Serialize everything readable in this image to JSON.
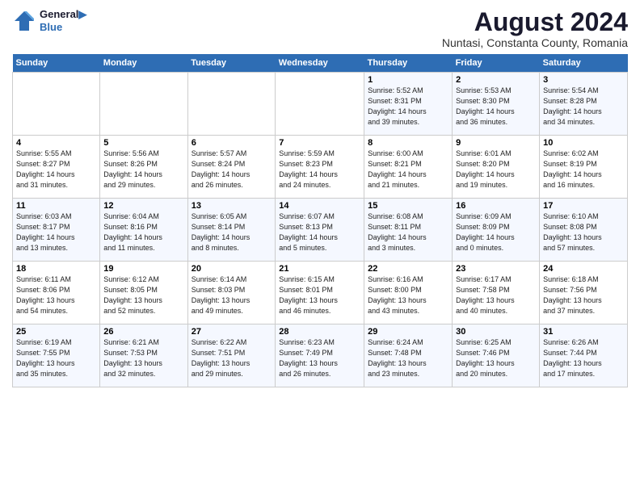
{
  "logo": {
    "line1": "General",
    "line2": "Blue"
  },
  "title": "August 2024",
  "subtitle": "Nuntasi, Constanta County, Romania",
  "days_of_week": [
    "Sunday",
    "Monday",
    "Tuesday",
    "Wednesday",
    "Thursday",
    "Friday",
    "Saturday"
  ],
  "weeks": [
    [
      {
        "day": "",
        "info": ""
      },
      {
        "day": "",
        "info": ""
      },
      {
        "day": "",
        "info": ""
      },
      {
        "day": "",
        "info": ""
      },
      {
        "day": "1",
        "info": "Sunrise: 5:52 AM\nSunset: 8:31 PM\nDaylight: 14 hours\nand 39 minutes."
      },
      {
        "day": "2",
        "info": "Sunrise: 5:53 AM\nSunset: 8:30 PM\nDaylight: 14 hours\nand 36 minutes."
      },
      {
        "day": "3",
        "info": "Sunrise: 5:54 AM\nSunset: 8:28 PM\nDaylight: 14 hours\nand 34 minutes."
      }
    ],
    [
      {
        "day": "4",
        "info": "Sunrise: 5:55 AM\nSunset: 8:27 PM\nDaylight: 14 hours\nand 31 minutes."
      },
      {
        "day": "5",
        "info": "Sunrise: 5:56 AM\nSunset: 8:26 PM\nDaylight: 14 hours\nand 29 minutes."
      },
      {
        "day": "6",
        "info": "Sunrise: 5:57 AM\nSunset: 8:24 PM\nDaylight: 14 hours\nand 26 minutes."
      },
      {
        "day": "7",
        "info": "Sunrise: 5:59 AM\nSunset: 8:23 PM\nDaylight: 14 hours\nand 24 minutes."
      },
      {
        "day": "8",
        "info": "Sunrise: 6:00 AM\nSunset: 8:21 PM\nDaylight: 14 hours\nand 21 minutes."
      },
      {
        "day": "9",
        "info": "Sunrise: 6:01 AM\nSunset: 8:20 PM\nDaylight: 14 hours\nand 19 minutes."
      },
      {
        "day": "10",
        "info": "Sunrise: 6:02 AM\nSunset: 8:19 PM\nDaylight: 14 hours\nand 16 minutes."
      }
    ],
    [
      {
        "day": "11",
        "info": "Sunrise: 6:03 AM\nSunset: 8:17 PM\nDaylight: 14 hours\nand 13 minutes."
      },
      {
        "day": "12",
        "info": "Sunrise: 6:04 AM\nSunset: 8:16 PM\nDaylight: 14 hours\nand 11 minutes."
      },
      {
        "day": "13",
        "info": "Sunrise: 6:05 AM\nSunset: 8:14 PM\nDaylight: 14 hours\nand 8 minutes."
      },
      {
        "day": "14",
        "info": "Sunrise: 6:07 AM\nSunset: 8:13 PM\nDaylight: 14 hours\nand 5 minutes."
      },
      {
        "day": "15",
        "info": "Sunrise: 6:08 AM\nSunset: 8:11 PM\nDaylight: 14 hours\nand 3 minutes."
      },
      {
        "day": "16",
        "info": "Sunrise: 6:09 AM\nSunset: 8:09 PM\nDaylight: 14 hours\nand 0 minutes."
      },
      {
        "day": "17",
        "info": "Sunrise: 6:10 AM\nSunset: 8:08 PM\nDaylight: 13 hours\nand 57 minutes."
      }
    ],
    [
      {
        "day": "18",
        "info": "Sunrise: 6:11 AM\nSunset: 8:06 PM\nDaylight: 13 hours\nand 54 minutes."
      },
      {
        "day": "19",
        "info": "Sunrise: 6:12 AM\nSunset: 8:05 PM\nDaylight: 13 hours\nand 52 minutes."
      },
      {
        "day": "20",
        "info": "Sunrise: 6:14 AM\nSunset: 8:03 PM\nDaylight: 13 hours\nand 49 minutes."
      },
      {
        "day": "21",
        "info": "Sunrise: 6:15 AM\nSunset: 8:01 PM\nDaylight: 13 hours\nand 46 minutes."
      },
      {
        "day": "22",
        "info": "Sunrise: 6:16 AM\nSunset: 8:00 PM\nDaylight: 13 hours\nand 43 minutes."
      },
      {
        "day": "23",
        "info": "Sunrise: 6:17 AM\nSunset: 7:58 PM\nDaylight: 13 hours\nand 40 minutes."
      },
      {
        "day": "24",
        "info": "Sunrise: 6:18 AM\nSunset: 7:56 PM\nDaylight: 13 hours\nand 37 minutes."
      }
    ],
    [
      {
        "day": "25",
        "info": "Sunrise: 6:19 AM\nSunset: 7:55 PM\nDaylight: 13 hours\nand 35 minutes."
      },
      {
        "day": "26",
        "info": "Sunrise: 6:21 AM\nSunset: 7:53 PM\nDaylight: 13 hours\nand 32 minutes."
      },
      {
        "day": "27",
        "info": "Sunrise: 6:22 AM\nSunset: 7:51 PM\nDaylight: 13 hours\nand 29 minutes."
      },
      {
        "day": "28",
        "info": "Sunrise: 6:23 AM\nSunset: 7:49 PM\nDaylight: 13 hours\nand 26 minutes."
      },
      {
        "day": "29",
        "info": "Sunrise: 6:24 AM\nSunset: 7:48 PM\nDaylight: 13 hours\nand 23 minutes."
      },
      {
        "day": "30",
        "info": "Sunrise: 6:25 AM\nSunset: 7:46 PM\nDaylight: 13 hours\nand 20 minutes."
      },
      {
        "day": "31",
        "info": "Sunrise: 6:26 AM\nSunset: 7:44 PM\nDaylight: 13 hours\nand 17 minutes."
      }
    ]
  ]
}
